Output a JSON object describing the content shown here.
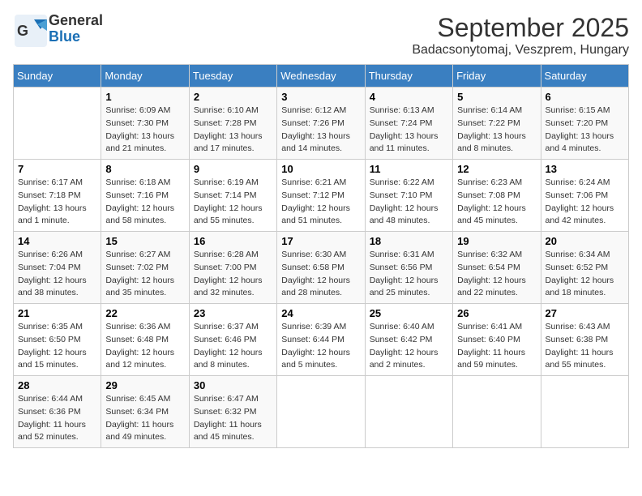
{
  "logo": {
    "line1": "General",
    "line2": "Blue"
  },
  "title": "September 2025",
  "subtitle": "Badacsonytomaj, Veszprem, Hungary",
  "days_of_week": [
    "Sunday",
    "Monday",
    "Tuesday",
    "Wednesday",
    "Thursday",
    "Friday",
    "Saturday"
  ],
  "weeks": [
    [
      {
        "day": "",
        "sunrise": "",
        "sunset": "",
        "daylight": ""
      },
      {
        "day": "1",
        "sunrise": "Sunrise: 6:09 AM",
        "sunset": "Sunset: 7:30 PM",
        "daylight": "Daylight: 13 hours and 21 minutes."
      },
      {
        "day": "2",
        "sunrise": "Sunrise: 6:10 AM",
        "sunset": "Sunset: 7:28 PM",
        "daylight": "Daylight: 13 hours and 17 minutes."
      },
      {
        "day": "3",
        "sunrise": "Sunrise: 6:12 AM",
        "sunset": "Sunset: 7:26 PM",
        "daylight": "Daylight: 13 hours and 14 minutes."
      },
      {
        "day": "4",
        "sunrise": "Sunrise: 6:13 AM",
        "sunset": "Sunset: 7:24 PM",
        "daylight": "Daylight: 13 hours and 11 minutes."
      },
      {
        "day": "5",
        "sunrise": "Sunrise: 6:14 AM",
        "sunset": "Sunset: 7:22 PM",
        "daylight": "Daylight: 13 hours and 8 minutes."
      },
      {
        "day": "6",
        "sunrise": "Sunrise: 6:15 AM",
        "sunset": "Sunset: 7:20 PM",
        "daylight": "Daylight: 13 hours and 4 minutes."
      }
    ],
    [
      {
        "day": "7",
        "sunrise": "Sunrise: 6:17 AM",
        "sunset": "Sunset: 7:18 PM",
        "daylight": "Daylight: 13 hours and 1 minute."
      },
      {
        "day": "8",
        "sunrise": "Sunrise: 6:18 AM",
        "sunset": "Sunset: 7:16 PM",
        "daylight": "Daylight: 12 hours and 58 minutes."
      },
      {
        "day": "9",
        "sunrise": "Sunrise: 6:19 AM",
        "sunset": "Sunset: 7:14 PM",
        "daylight": "Daylight: 12 hours and 55 minutes."
      },
      {
        "day": "10",
        "sunrise": "Sunrise: 6:21 AM",
        "sunset": "Sunset: 7:12 PM",
        "daylight": "Daylight: 12 hours and 51 minutes."
      },
      {
        "day": "11",
        "sunrise": "Sunrise: 6:22 AM",
        "sunset": "Sunset: 7:10 PM",
        "daylight": "Daylight: 12 hours and 48 minutes."
      },
      {
        "day": "12",
        "sunrise": "Sunrise: 6:23 AM",
        "sunset": "Sunset: 7:08 PM",
        "daylight": "Daylight: 12 hours and 45 minutes."
      },
      {
        "day": "13",
        "sunrise": "Sunrise: 6:24 AM",
        "sunset": "Sunset: 7:06 PM",
        "daylight": "Daylight: 12 hours and 42 minutes."
      }
    ],
    [
      {
        "day": "14",
        "sunrise": "Sunrise: 6:26 AM",
        "sunset": "Sunset: 7:04 PM",
        "daylight": "Daylight: 12 hours and 38 minutes."
      },
      {
        "day": "15",
        "sunrise": "Sunrise: 6:27 AM",
        "sunset": "Sunset: 7:02 PM",
        "daylight": "Daylight: 12 hours and 35 minutes."
      },
      {
        "day": "16",
        "sunrise": "Sunrise: 6:28 AM",
        "sunset": "Sunset: 7:00 PM",
        "daylight": "Daylight: 12 hours and 32 minutes."
      },
      {
        "day": "17",
        "sunrise": "Sunrise: 6:30 AM",
        "sunset": "Sunset: 6:58 PM",
        "daylight": "Daylight: 12 hours and 28 minutes."
      },
      {
        "day": "18",
        "sunrise": "Sunrise: 6:31 AM",
        "sunset": "Sunset: 6:56 PM",
        "daylight": "Daylight: 12 hours and 25 minutes."
      },
      {
        "day": "19",
        "sunrise": "Sunrise: 6:32 AM",
        "sunset": "Sunset: 6:54 PM",
        "daylight": "Daylight: 12 hours and 22 minutes."
      },
      {
        "day": "20",
        "sunrise": "Sunrise: 6:34 AM",
        "sunset": "Sunset: 6:52 PM",
        "daylight": "Daylight: 12 hours and 18 minutes."
      }
    ],
    [
      {
        "day": "21",
        "sunrise": "Sunrise: 6:35 AM",
        "sunset": "Sunset: 6:50 PM",
        "daylight": "Daylight: 12 hours and 15 minutes."
      },
      {
        "day": "22",
        "sunrise": "Sunrise: 6:36 AM",
        "sunset": "Sunset: 6:48 PM",
        "daylight": "Daylight: 12 hours and 12 minutes."
      },
      {
        "day": "23",
        "sunrise": "Sunrise: 6:37 AM",
        "sunset": "Sunset: 6:46 PM",
        "daylight": "Daylight: 12 hours and 8 minutes."
      },
      {
        "day": "24",
        "sunrise": "Sunrise: 6:39 AM",
        "sunset": "Sunset: 6:44 PM",
        "daylight": "Daylight: 12 hours and 5 minutes."
      },
      {
        "day": "25",
        "sunrise": "Sunrise: 6:40 AM",
        "sunset": "Sunset: 6:42 PM",
        "daylight": "Daylight: 12 hours and 2 minutes."
      },
      {
        "day": "26",
        "sunrise": "Sunrise: 6:41 AM",
        "sunset": "Sunset: 6:40 PM",
        "daylight": "Daylight: 11 hours and 59 minutes."
      },
      {
        "day": "27",
        "sunrise": "Sunrise: 6:43 AM",
        "sunset": "Sunset: 6:38 PM",
        "daylight": "Daylight: 11 hours and 55 minutes."
      }
    ],
    [
      {
        "day": "28",
        "sunrise": "Sunrise: 6:44 AM",
        "sunset": "Sunset: 6:36 PM",
        "daylight": "Daylight: 11 hours and 52 minutes."
      },
      {
        "day": "29",
        "sunrise": "Sunrise: 6:45 AM",
        "sunset": "Sunset: 6:34 PM",
        "daylight": "Daylight: 11 hours and 49 minutes."
      },
      {
        "day": "30",
        "sunrise": "Sunrise: 6:47 AM",
        "sunset": "Sunset: 6:32 PM",
        "daylight": "Daylight: 11 hours and 45 minutes."
      },
      {
        "day": "",
        "sunrise": "",
        "sunset": "",
        "daylight": ""
      },
      {
        "day": "",
        "sunrise": "",
        "sunset": "",
        "daylight": ""
      },
      {
        "day": "",
        "sunrise": "",
        "sunset": "",
        "daylight": ""
      },
      {
        "day": "",
        "sunrise": "",
        "sunset": "",
        "daylight": ""
      }
    ]
  ]
}
